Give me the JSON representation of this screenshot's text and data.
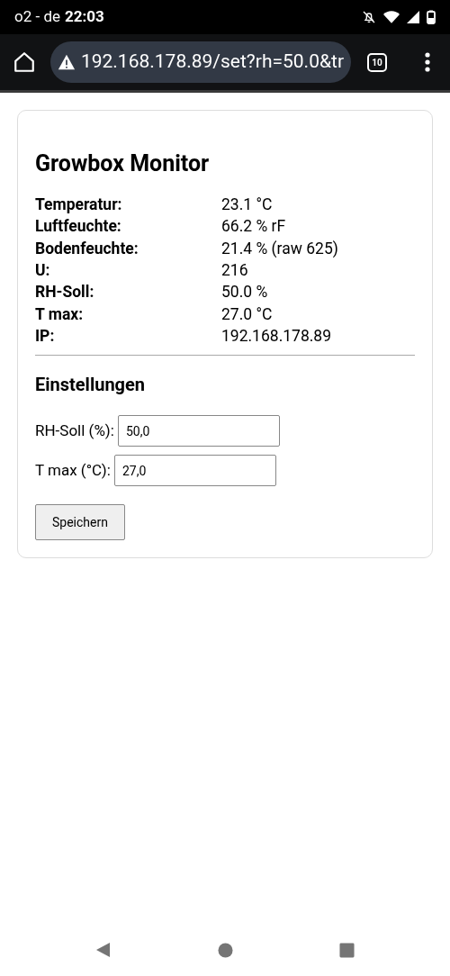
{
  "status_bar": {
    "carrier": "o2 - de",
    "time": "22:03"
  },
  "browser": {
    "url": "192.168.178.89/set?rh=50.0&tr",
    "tab_count": "10"
  },
  "page": {
    "title": "Growbox Monitor",
    "readings": [
      {
        "label": "Temperatur:",
        "value": "23.1 °C"
      },
      {
        "label": "Luftfeuchte:",
        "value": "66.2 % rF"
      },
      {
        "label": "Bodenfeuchte:",
        "value": "21.4 % (raw 625)"
      },
      {
        "label": "U:",
        "value": "216"
      },
      {
        "label": "RH-Soll:",
        "value": "50.0 %"
      },
      {
        "label": "T max:",
        "value": "27.0 °C"
      },
      {
        "label": "IP:",
        "value": "192.168.178.89"
      }
    ],
    "settings_title": "Einstellungen",
    "fields": [
      {
        "label": "RH-Soll (%):",
        "value": "50,0"
      },
      {
        "label": "T max (°C):",
        "value": "27,0"
      }
    ],
    "button": "Speichern"
  }
}
